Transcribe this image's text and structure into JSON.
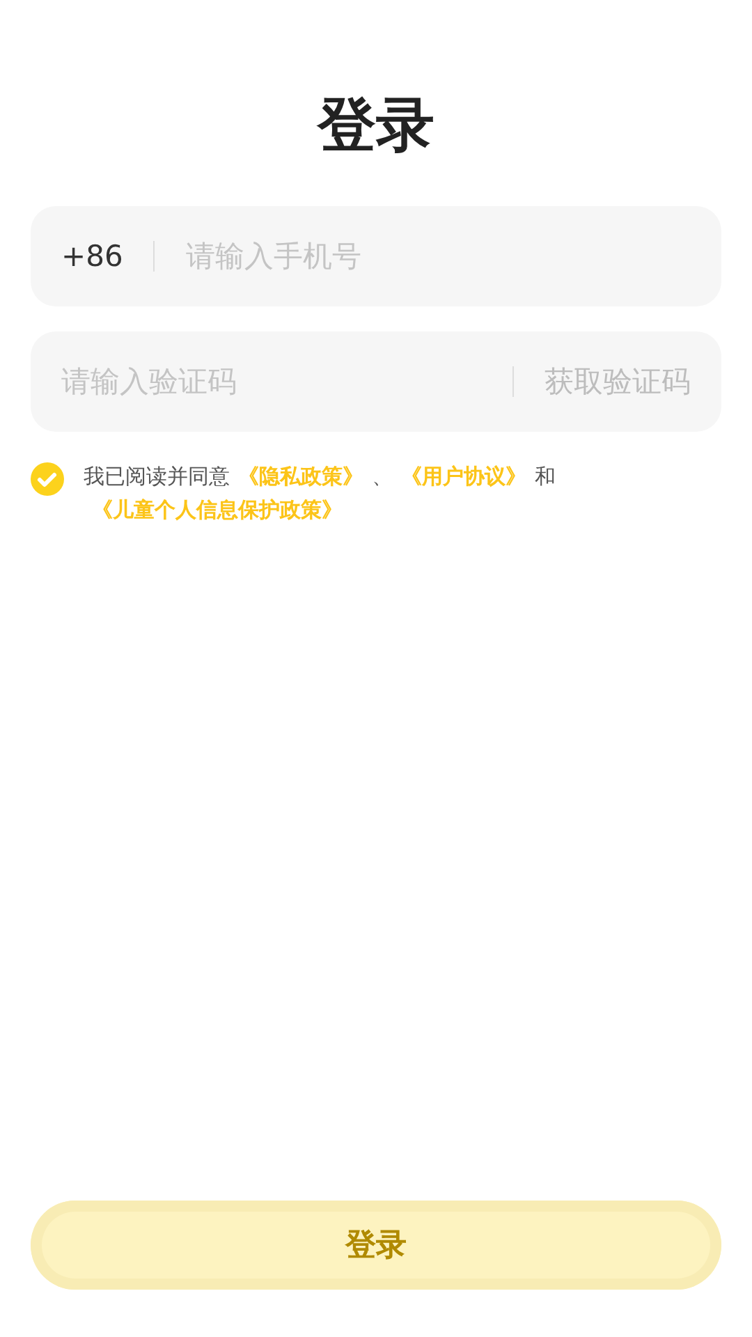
{
  "title": "登录",
  "phone": {
    "prefix": "+86",
    "placeholder": "请输入手机号"
  },
  "code": {
    "placeholder": "请输入验证码",
    "action": "获取验证码"
  },
  "agreement": {
    "checked": true,
    "parts": [
      {
        "kind": "text",
        "text": "我已阅读并同意"
      },
      {
        "kind": "link",
        "text": "《隐私政策》"
      },
      {
        "kind": "text",
        "text": "、"
      },
      {
        "kind": "link",
        "text": "《用户协议》"
      },
      {
        "kind": "text",
        "text": "和"
      },
      {
        "kind": "link",
        "text": "《儿童个人信息保护政策》"
      }
    ]
  },
  "login_button": {
    "label": "登录",
    "disabled": true
  }
}
